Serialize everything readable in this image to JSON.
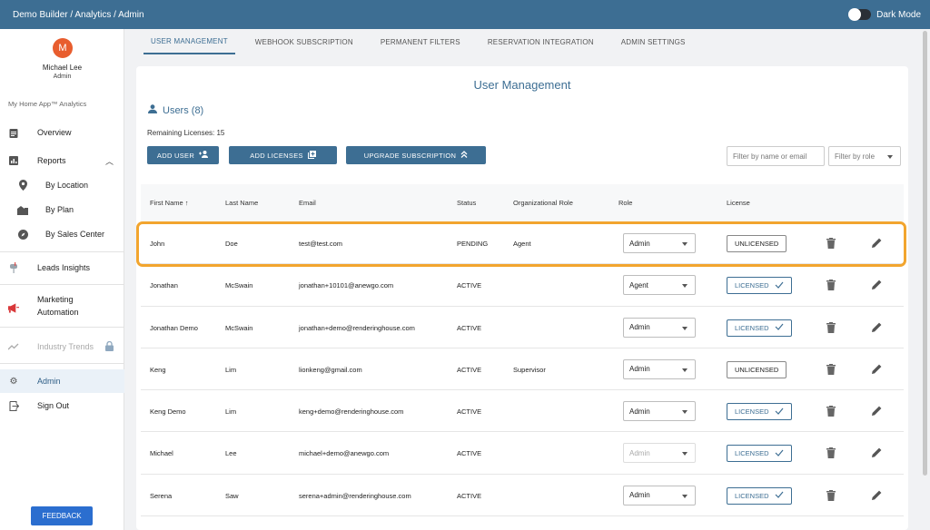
{
  "topbar": {
    "breadcrumb": "Demo Builder  /  Analytics / Admin",
    "dark_mode_label": "Dark Mode"
  },
  "sidebar": {
    "avatar_initial": "M",
    "user_name": "Michael Lee",
    "user_role": "Admin",
    "app_name": "My Home App™ Analytics",
    "items": [
      {
        "label": "Overview",
        "icon": "clipboard-icon"
      },
      {
        "label": "Reports",
        "icon": "bar-chart-icon"
      },
      {
        "label": "By Location",
        "icon": "location-pin-icon"
      },
      {
        "label": "By Plan",
        "icon": "floor-plan-icon"
      },
      {
        "label": "By Sales Center",
        "icon": "compass-icon"
      },
      {
        "label": "Leads Insights",
        "icon": "mailbox-icon"
      },
      {
        "label": "Marketing",
        "label2": "Automation",
        "icon": "megaphone-icon"
      },
      {
        "label": "Industry Trends",
        "icon": "trend-icon"
      },
      {
        "label": "Admin",
        "icon": "gear-icon"
      },
      {
        "label": "Sign Out",
        "icon": "sign-out-icon"
      }
    ],
    "feedback_label": "FEEDBACK"
  },
  "tabs": [
    "USER MANAGEMENT",
    "WEBHOOK SUBSCRIPTION",
    "PERMANENT FILTERS",
    "RESERVATION INTEGRATION",
    "ADMIN SETTINGS"
  ],
  "main": {
    "title": "User Management",
    "users_label": "Users (8)",
    "remaining": "Remaining Licenses: 15",
    "buttons": {
      "add_user": "ADD USER",
      "add_licenses": "ADD LICENSES",
      "upgrade": "UPGRADE SUBSCRIPTION"
    },
    "filter_name_placeholder": "Filter by name or email",
    "filter_role": "Filter by role"
  },
  "table": {
    "headers": [
      "First Name",
      "Last Name",
      "Email",
      "Status",
      "Organizational Role",
      "Role",
      "License"
    ],
    "rows": [
      {
        "first": "John",
        "last": "Doe",
        "email": "test@test.com",
        "status": "PENDING",
        "org": "Agent",
        "role": "Admin",
        "license": "UNLICENSED",
        "licensed": false,
        "role_disabled": false
      },
      {
        "first": "Jonathan",
        "last": "McSwain",
        "email": "jonathan+10101@anewgo.com",
        "status": "ACTIVE",
        "org": "",
        "role": "Agent",
        "license": "LICENSED",
        "licensed": true,
        "role_disabled": false
      },
      {
        "first": "Jonathan Demo",
        "last": "McSwain",
        "email": "jonathan+demo@renderinghouse.com",
        "status": "ACTIVE",
        "org": "",
        "role": "Admin",
        "license": "LICENSED",
        "licensed": true,
        "role_disabled": false
      },
      {
        "first": "Keng",
        "last": "Lim",
        "email": "lionkeng@gmail.com",
        "status": "ACTIVE",
        "org": "Supervisor",
        "role": "Admin",
        "license": "UNLICENSED",
        "licensed": false,
        "role_disabled": false
      },
      {
        "first": "Keng Demo",
        "last": "Lim",
        "email": "keng+demo@renderinghouse.com",
        "status": "ACTIVE",
        "org": "",
        "role": "Admin",
        "license": "LICENSED",
        "licensed": true,
        "role_disabled": false
      },
      {
        "first": "Michael",
        "last": "Lee",
        "email": "michael+demo@anewgo.com",
        "status": "ACTIVE",
        "org": "",
        "role": "Admin",
        "license": "LICENSED",
        "licensed": true,
        "role_disabled": true
      },
      {
        "first": "Serena",
        "last": "Saw",
        "email": "serena+admin@renderinghouse.com",
        "status": "ACTIVE",
        "org": "",
        "role": "Admin",
        "license": "LICENSED",
        "licensed": true,
        "role_disabled": false
      }
    ]
  },
  "colors": {
    "accent": "#3d6e93",
    "highlight": "#f2a52e",
    "avatar": "#e85d2e",
    "feedback": "#2b6ecf"
  }
}
